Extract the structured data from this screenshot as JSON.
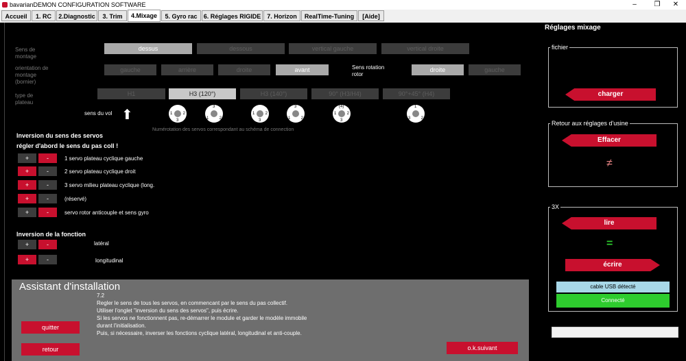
{
  "window": {
    "title": "bavarianDEMON CONFIGURATION SOFTWARE",
    "minimize": "–",
    "maximize": "❐",
    "close": "✕"
  },
  "tabs": [
    "Accueil",
    "1. RC",
    "2.Diagnostic",
    "3. Trim",
    "4.Mixage",
    "5. Gyro rac",
    "6. Réglages RIGIDE",
    "7. Horizon",
    "RealTime-Tuning",
    "[Aide]"
  ],
  "mounting": {
    "sens_label": "Sens de montage",
    "sens_options": [
      "dessus",
      "dessous",
      "vertical gauche",
      "vertical droite"
    ],
    "orientation_label": "orientation de montage (bornier)",
    "orientation_options": [
      "gauche",
      "arrière",
      "droite",
      "avant"
    ],
    "rotor_label": "Sens rotation rotor",
    "rotor_options": [
      "droite",
      "gauche"
    ],
    "plateau_label": "type de plateau",
    "plateau_options": [
      "H1",
      "H3 (120°)",
      "H3 (140°)",
      "90° (H3/H4)",
      "90°+45° (H4)"
    ],
    "sens_du_vol": "sens du vol",
    "numerotation": "Numérotation des servos correspondant au schéma de connection"
  },
  "servos": {
    "title": "Inversion du sens des servos",
    "subtitle": "régler d'abord le sens du pas coll !",
    "plus": "+",
    "minus": "-",
    "items": [
      "1 servo plateau cyclique gauche",
      "2 servo plateau cyclique droit",
      "3 servo milieu plateau cyclique (long.",
      "(réservé)",
      "servo rotor anticouple et sens gyro"
    ]
  },
  "fonction": {
    "title": "Inversion de la fonction",
    "items": [
      "latéral",
      "longitudinal"
    ]
  },
  "assistant": {
    "title": "Assistant d'installation",
    "step": "7.2",
    "lines": [
      "Regler le sens de tous les servos, en commencant par le sens du pas collectif.",
      "Utiliser l'onglet \"inversion du sens des servos\", puis écrire.",
      "Si les servos ne fonctionnent pas, re-démarrer le module et garder le modèle immobile",
      "durant  l'initialisation.",
      "Puis, si nécessaire, inverser les fonctions cyclique latéral, longitudinal et anti-couple."
    ],
    "quit": "quitter",
    "back": "retour",
    "next": "o.k.suivant"
  },
  "sidebar": {
    "title": "Réglages mixage",
    "fichier_label": "fichier",
    "charger": "charger",
    "reset_label": "Retour aux réglages d'usine",
    "effacer": "Effacer",
    "neq": "≠",
    "group_3x": "3X",
    "lire": "lire",
    "eq": "=",
    "ecrire": "écrire",
    "usb": "cable USB détecté",
    "connected": "Connecté"
  },
  "colors": {
    "accent": "#c8102e",
    "connected": "#2ecc2e",
    "usb": "#a8d8e8"
  }
}
